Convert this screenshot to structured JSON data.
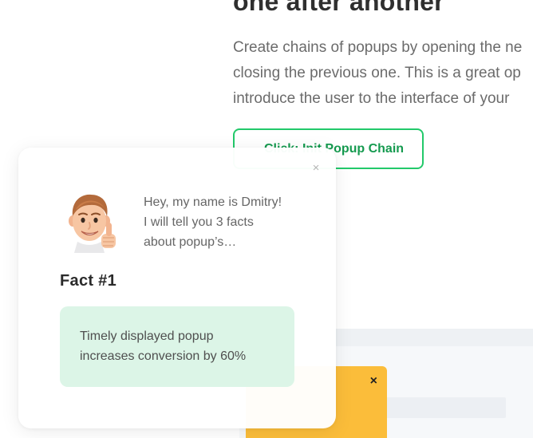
{
  "section": {
    "heading": "one after another",
    "paragraph_lines": [
      "Create chains of popups by opening the ne",
      "closing the previous one. This is a great op",
      "introduce the user to the interface of your"
    ],
    "button_label": "Click: Init Popup Chain"
  },
  "popup": {
    "close_glyph": "×",
    "avatar_icon": "memoji-thumbs-up-icon",
    "intro_lines": [
      "Hey, my name is Dmitry!",
      "I will tell you 3 facts",
      "about popup’s…"
    ],
    "fact_title": "Fact #1",
    "fact_lines": [
      "Timely displayed popup",
      "increases conversion by 60%"
    ],
    "fact_bg_color": "#dcf5e7"
  },
  "mockup": {
    "yellow_popup_close": "×",
    "yellow_color": "#fbbd3a"
  },
  "colors": {
    "accent_green": "#22c96a",
    "button_text": "#159a4f"
  }
}
